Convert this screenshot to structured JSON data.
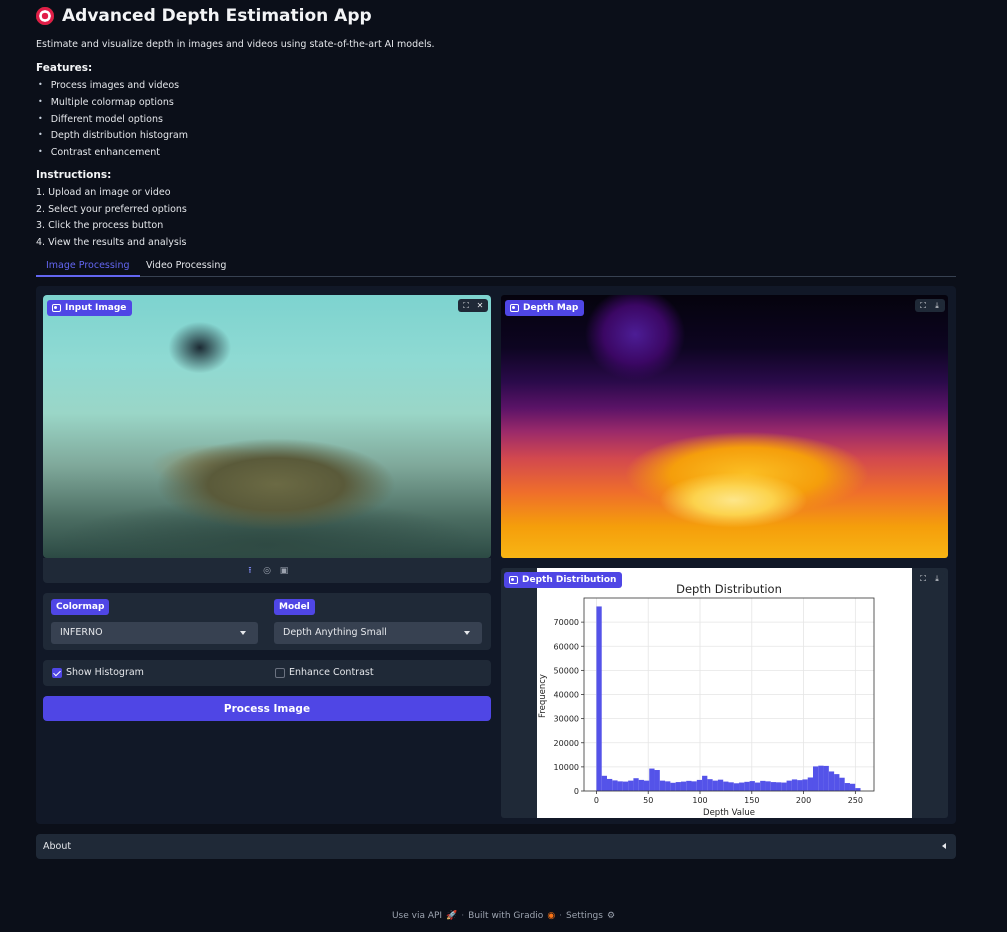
{
  "app": {
    "title": "Advanced Depth Estimation App",
    "description": "Estimate and visualize depth in images and videos using state-of-the-art AI models."
  },
  "features": {
    "heading": "Features:",
    "items": [
      "Process images and videos",
      "Multiple colormap options",
      "Different model options",
      "Depth distribution histogram",
      "Contrast enhancement"
    ]
  },
  "instructions": {
    "heading": "Instructions:",
    "items": [
      "1. Upload an image or video",
      "2. Select your preferred options",
      "3. Click the process button",
      "4. View the results and analysis"
    ]
  },
  "tabs": [
    {
      "label": "Image Processing",
      "active": true
    },
    {
      "label": "Video Processing",
      "active": false
    }
  ],
  "input_image": {
    "label": "Input Image"
  },
  "depth_map": {
    "label": "Depth Map"
  },
  "histogram_panel": {
    "label": "Depth Distribution"
  },
  "colormap": {
    "label": "Colormap",
    "value": "INFERNO"
  },
  "model": {
    "label": "Model",
    "value": "Depth Anything Small"
  },
  "show_histogram": {
    "label": "Show Histogram",
    "checked": true
  },
  "enhance_contrast": {
    "label": "Enhance Contrast",
    "checked": false
  },
  "process_button": "Process Image",
  "about": {
    "label": "About"
  },
  "footer": {
    "api": "Use via API",
    "built": "Built with Gradio",
    "settings": "Settings"
  },
  "colors": {
    "accent": "#4f46e5",
    "background": "#0b0f19",
    "panel": "#1f2937",
    "bar": "#4b4ae8"
  },
  "chart_data": {
    "type": "bar",
    "title": "Depth Distribution",
    "xlabel": "Depth Value",
    "ylabel": "Frequency",
    "xlim": [
      -12,
      268
    ],
    "ylim": [
      0,
      80000
    ],
    "xticks": [
      0,
      50,
      100,
      150,
      200,
      250
    ],
    "yticks": [
      0,
      10000,
      20000,
      30000,
      40000,
      50000,
      60000,
      70000
    ],
    "grid": true,
    "bin_width": 5.1,
    "bin_starts": [
      0,
      5.1,
      10.2,
      15.3,
      20.4,
      25.5,
      30.6,
      35.7,
      40.8,
      45.9,
      51,
      56.1,
      61.2,
      66.3,
      71.4,
      76.5,
      81.6,
      86.7,
      91.8,
      96.9,
      102,
      107.1,
      112.2,
      117.3,
      122.4,
      127.5,
      132.6,
      137.7,
      142.8,
      147.9,
      153,
      158.1,
      163.2,
      168.3,
      173.4,
      178.5,
      183.6,
      188.7,
      193.8,
      198.9,
      204,
      209.1,
      214.2,
      219.3,
      224.4,
      229.5,
      234.6,
      239.7,
      244.8,
      249.9
    ],
    "values": [
      76500,
      6300,
      5000,
      4400,
      4000,
      3900,
      4300,
      5300,
      4600,
      4300,
      9300,
      8700,
      4300,
      4000,
      3400,
      3700,
      3900,
      4200,
      4000,
      4600,
      6300,
      4900,
      4300,
      4700,
      3900,
      3600,
      3200,
      3500,
      3800,
      4100,
      3500,
      4200,
      4000,
      3700,
      3600,
      3500,
      4300,
      4800,
      4500,
      4800,
      5600,
      10200,
      10500,
      10400,
      8100,
      7000,
      5500,
      3300,
      3000,
      1200
    ]
  }
}
